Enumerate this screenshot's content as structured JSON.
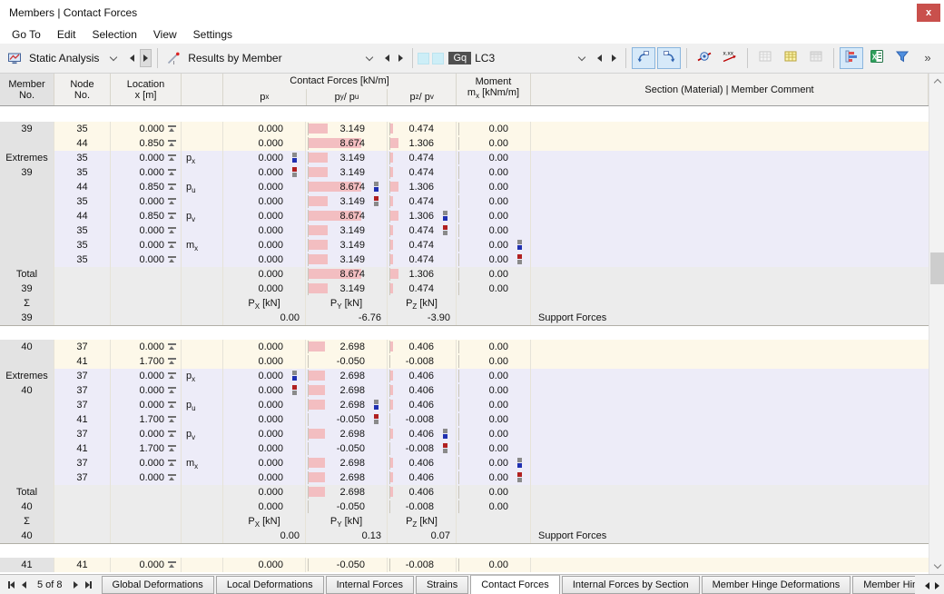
{
  "window": {
    "title": "Members | Contact Forces",
    "close_glyph": "x"
  },
  "menu": {
    "items": [
      "Go To",
      "Edit",
      "Selection",
      "View",
      "Settings"
    ]
  },
  "toolbar": {
    "analysis": {
      "label": "Static Analysis",
      "icon": "static-analysis-icon"
    },
    "results": {
      "label": "Results by Member",
      "icon": "results-by-member-icon"
    },
    "loadcase": {
      "badge": "Gq",
      "label": "LC3",
      "color_squares": 2
    },
    "buttons": [
      {
        "name": "pick-object-button",
        "icon": "pick-object-icon",
        "state": "active"
      },
      {
        "name": "jump-to-table-button",
        "icon": "jump-to-table-icon",
        "state": "active"
      },
      {
        "sep": true
      },
      {
        "name": "show-result-values-button",
        "icon": "result-values-icon",
        "state": "normal"
      },
      {
        "name": "decimal-places-button",
        "icon": "decimal-places-icon",
        "state": "normal"
      },
      {
        "sep": true
      },
      {
        "name": "table-view-button",
        "icon": "table-grid-icon",
        "state": "disabled"
      },
      {
        "name": "table-edit-button",
        "icon": "table-edit-icon",
        "state": "normal"
      },
      {
        "name": "table-readonly-button",
        "icon": "table-readonly-icon",
        "state": "disabled"
      },
      {
        "sep": true
      },
      {
        "name": "result-diagram-button",
        "icon": "result-diagram-icon",
        "state": "active"
      },
      {
        "name": "excel-export-button",
        "icon": "excel-export-icon",
        "state": "normal"
      },
      {
        "name": "filter-button",
        "icon": "filter-icon",
        "state": "normal"
      },
      {
        "name": "toolbar-overflow-button",
        "icon": "overflow-icon",
        "state": "normal"
      }
    ]
  },
  "table": {
    "header": {
      "member": [
        "Member",
        "No."
      ],
      "node": [
        "Node",
        "No."
      ],
      "location": [
        "Location",
        "x [m]"
      ],
      "group": "Contact Forces [kN/m]",
      "sub": [
        "p_x",
        "p_y / p_u",
        "p_z / p_v"
      ],
      "moment": [
        "Moment",
        "m_x [kNm/m]"
      ],
      "section": "Section (Material) | Member Comment"
    },
    "bar_scale_max": 8.674,
    "blocks": [
      {
        "rows": [
          {
            "t": "d",
            "m": "39",
            "n": "35",
            "x": "0.000",
            "px": "0.000",
            "py": "3.149",
            "pz": "0.474",
            "mx": "0.00"
          },
          {
            "t": "d",
            "n": "44",
            "x": "0.850",
            "px": "0.000",
            "py": "8.674",
            "pz": "1.306",
            "mx": "0.00"
          },
          {
            "t": "e",
            "m": "Extremes",
            "n": "35",
            "x": "0.000",
            "lbl": "p_x",
            "px": "0.000",
            "pxm": "max",
            "py": "3.149",
            "pz": "0.474",
            "mx": "0.00"
          },
          {
            "t": "e",
            "m": "39",
            "n": "35",
            "x": "0.000",
            "px": "0.000",
            "pxm": "min",
            "py": "3.149",
            "pz": "0.474",
            "mx": "0.00"
          },
          {
            "t": "e",
            "n": "44",
            "x": "0.850",
            "lbl": "p_u",
            "px": "0.000",
            "py": "8.674",
            "pym": "max",
            "pz": "1.306",
            "mx": "0.00"
          },
          {
            "t": "e",
            "n": "35",
            "x": "0.000",
            "px": "0.000",
            "py": "3.149",
            "pym": "min",
            "pz": "0.474",
            "mx": "0.00"
          },
          {
            "t": "e",
            "n": "44",
            "x": "0.850",
            "lbl": "p_v",
            "px": "0.000",
            "py": "8.674",
            "pz": "1.306",
            "pzm": "max",
            "mx": "0.00"
          },
          {
            "t": "e",
            "n": "35",
            "x": "0.000",
            "px": "0.000",
            "py": "3.149",
            "pz": "0.474",
            "pzm": "min",
            "mx": "0.00"
          },
          {
            "t": "e",
            "n": "35",
            "x": "0.000",
            "lbl": "m_x",
            "px": "0.000",
            "py": "3.149",
            "pz": "0.474",
            "mx": "0.00",
            "mxm": "max"
          },
          {
            "t": "e",
            "n": "35",
            "x": "0.000",
            "px": "0.000",
            "py": "3.149",
            "pz": "0.474",
            "mx": "0.00",
            "mxm": "min"
          },
          {
            "t": "t",
            "m": "Total",
            "px": "0.000",
            "py": "8.674",
            "pz": "1.306",
            "mx": "0.00"
          },
          {
            "t": "t",
            "m": "39",
            "px": "0.000",
            "py": "3.149",
            "pz": "0.474",
            "mx": "0.00"
          },
          {
            "t": "sh",
            "m": "Σ",
            "px": "P_X [kN]",
            "py": "P_Y [kN]",
            "pz": "P_Z [kN]"
          },
          {
            "t": "sv",
            "m": "39",
            "px": "0.00",
            "py": "-6.76",
            "pz": "-3.90",
            "sec": "Support Forces"
          }
        ]
      },
      {
        "rows": [
          {
            "t": "d",
            "m": "40",
            "n": "37",
            "x": "0.000",
            "px": "0.000",
            "py": "2.698",
            "pz": "0.406",
            "mx": "0.00"
          },
          {
            "t": "d",
            "n": "41",
            "x": "1.700",
            "px": "0.000",
            "py": "-0.050",
            "pz": "-0.008",
            "mx": "0.00"
          },
          {
            "t": "e",
            "m": "Extremes",
            "n": "37",
            "x": "0.000",
            "lbl": "p_x",
            "px": "0.000",
            "pxm": "max",
            "py": "2.698",
            "pz": "0.406",
            "mx": "0.00"
          },
          {
            "t": "e",
            "m": "40",
            "n": "37",
            "x": "0.000",
            "px": "0.000",
            "pxm": "min",
            "py": "2.698",
            "pz": "0.406",
            "mx": "0.00"
          },
          {
            "t": "e",
            "n": "37",
            "x": "0.000",
            "lbl": "p_u",
            "px": "0.000",
            "py": "2.698",
            "pym": "max",
            "pz": "0.406",
            "mx": "0.00"
          },
          {
            "t": "e",
            "n": "41",
            "x": "1.700",
            "px": "0.000",
            "py": "-0.050",
            "pym": "min",
            "pz": "-0.008",
            "mx": "0.00"
          },
          {
            "t": "e",
            "n": "37",
            "x": "0.000",
            "lbl": "p_v",
            "px": "0.000",
            "py": "2.698",
            "pz": "0.406",
            "pzm": "max",
            "mx": "0.00"
          },
          {
            "t": "e",
            "n": "41",
            "x": "1.700",
            "px": "0.000",
            "py": "-0.050",
            "pz": "-0.008",
            "pzm": "min",
            "mx": "0.00"
          },
          {
            "t": "e",
            "n": "37",
            "x": "0.000",
            "lbl": "m_x",
            "px": "0.000",
            "py": "2.698",
            "pz": "0.406",
            "mx": "0.00",
            "mxm": "max"
          },
          {
            "t": "e",
            "n": "37",
            "x": "0.000",
            "px": "0.000",
            "py": "2.698",
            "pz": "0.406",
            "mx": "0.00",
            "mxm": "min"
          },
          {
            "t": "t",
            "m": "Total",
            "px": "0.000",
            "py": "2.698",
            "pz": "0.406",
            "mx": "0.00"
          },
          {
            "t": "t",
            "m": "40",
            "px": "0.000",
            "py": "-0.050",
            "pz": "-0.008",
            "mx": "0.00"
          },
          {
            "t": "sh",
            "m": "Σ",
            "px": "P_X [kN]",
            "py": "P_Y [kN]",
            "pz": "P_Z [kN]"
          },
          {
            "t": "sv",
            "m": "40",
            "px": "0.00",
            "py": "0.13",
            "pz": "0.07",
            "sec": "Support Forces"
          }
        ]
      },
      {
        "rows": [
          {
            "t": "d",
            "m": "41",
            "n": "41",
            "x": "0.000",
            "px": "0.000",
            "py": "-0.050",
            "pz": "-0.008",
            "mx": "0.00"
          }
        ]
      }
    ]
  },
  "tabbar": {
    "pager_label": "5 of 8",
    "tabs": [
      {
        "label": "Global Deformations"
      },
      {
        "label": "Local Deformations"
      },
      {
        "label": "Internal Forces"
      },
      {
        "label": "Strains"
      },
      {
        "label": "Contact Forces",
        "active": true
      },
      {
        "label": "Internal Forces by Section"
      },
      {
        "label": "Member Hinge Deformations"
      },
      {
        "label": "Member Hinge"
      }
    ]
  }
}
